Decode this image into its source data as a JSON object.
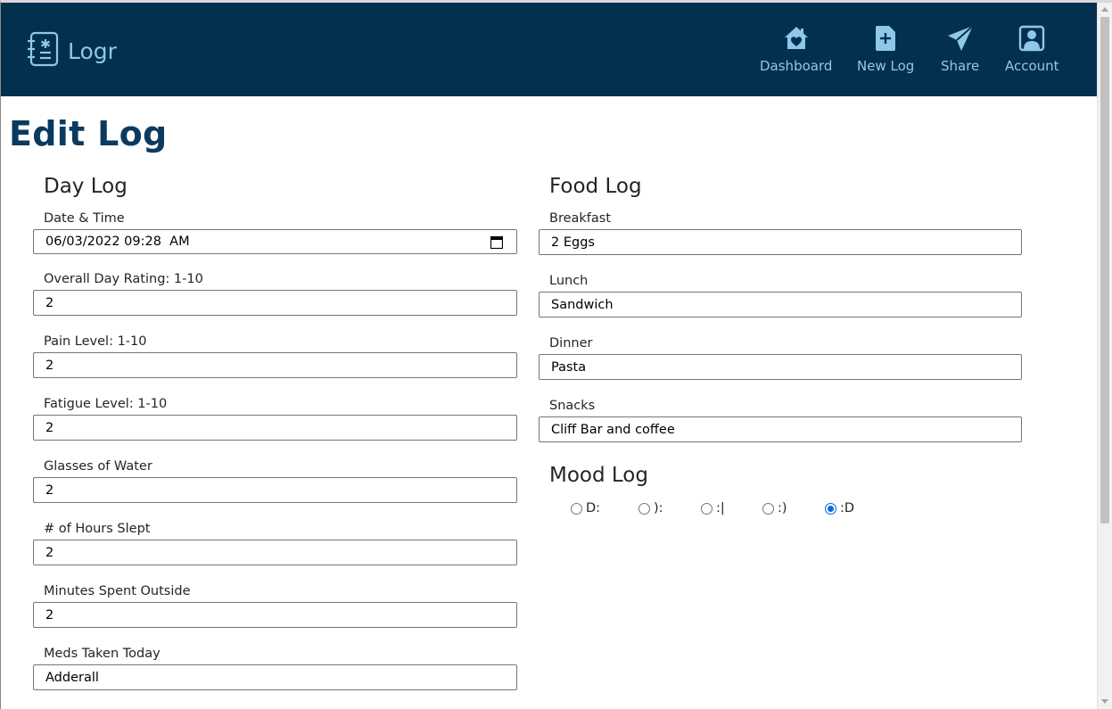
{
  "app": {
    "name": "Logr",
    "colors": {
      "navbar": "#043050",
      "nav_text": "#8fc8e8",
      "title": "#0b3a5e",
      "radio_checked": "#0a69e0"
    }
  },
  "nav": [
    {
      "label": "Dashboard",
      "icon": "house-heart-icon"
    },
    {
      "label": "New Log",
      "icon": "file-plus-icon"
    },
    {
      "label": "Share",
      "icon": "send-icon"
    },
    {
      "label": "Account",
      "icon": "person-square-icon"
    }
  ],
  "page": {
    "title": "Edit Log"
  },
  "day_log": {
    "title": "Day Log",
    "fields": [
      {
        "label": "Date & Time",
        "value": "06/03/2022 09:28  AM"
      },
      {
        "label": "Overall Day Rating: 1-10",
        "value": "2"
      },
      {
        "label": "Pain Level: 1-10",
        "value": "2"
      },
      {
        "label": "Fatigue Level: 1-10",
        "value": "2"
      },
      {
        "label": "Glasses of Water",
        "value": "2"
      },
      {
        "label": "# of Hours Slept",
        "value": "2"
      },
      {
        "label": "Minutes Spent Outside",
        "value": "2"
      },
      {
        "label": "Meds Taken Today",
        "value": "Adderall"
      }
    ]
  },
  "food_log": {
    "title": "Food Log",
    "fields": [
      {
        "label": "Breakfast",
        "value": "2 Eggs"
      },
      {
        "label": "Lunch",
        "value": "Sandwich"
      },
      {
        "label": "Dinner",
        "value": "Pasta"
      },
      {
        "label": "Snacks",
        "value": "Cliff Bar and coffee"
      }
    ]
  },
  "mood_log": {
    "title": "Mood Log",
    "options": [
      {
        "label": "D:",
        "checked": false
      },
      {
        "label": "):",
        "checked": false
      },
      {
        "label": ":|",
        "checked": false
      },
      {
        "label": ":)",
        "checked": false
      },
      {
        "label": ":D",
        "checked": true
      }
    ]
  }
}
